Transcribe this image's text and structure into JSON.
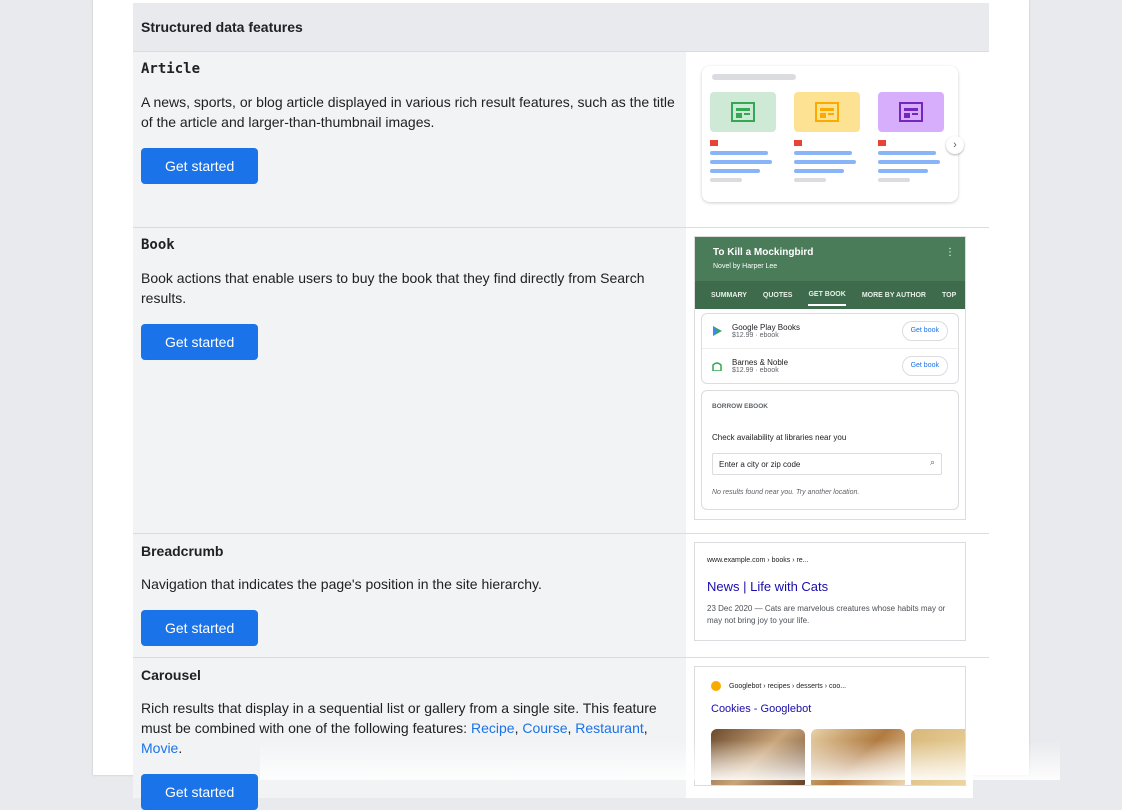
{
  "table": {
    "header": "Structured data features"
  },
  "rows": [
    {
      "name": "Article",
      "description": "A news, sports, or blog article displayed in various rich result features, such as the title of the article and larger-than-thumbnail images.",
      "button": "Get started"
    },
    {
      "name": "Book",
      "description": "Book actions that enable users to buy the book that they find directly from Search results.",
      "button": "Get started"
    },
    {
      "name": "Breadcrumb",
      "description": "Navigation that indicates the page's position in the site hierarchy.",
      "button": "Get started"
    },
    {
      "name": "Carousel",
      "description_prefix": "Rich results that display in a sequential list or gallery from a single site. This feature must be combined with one of the following features: ",
      "links": [
        "Recipe",
        "Course",
        "Restaurant",
        "Movie"
      ],
      "button": "Get started"
    }
  ],
  "book_preview": {
    "title": "To Kill a Mockingbird",
    "subtitle": "Novel by Harper Lee",
    "tabs": [
      "SUMMARY",
      "QUOTES",
      "GET BOOK",
      "MORE BY AUTHOR",
      "TOP"
    ],
    "sellers": [
      {
        "name": "Google Play Books",
        "price": "$12.99 · ebook",
        "action": "Get book"
      },
      {
        "name": "Barnes & Noble",
        "price": "$12.99 · ebook",
        "action": "Get book"
      }
    ],
    "borrow_header": "BORROW EBOOK",
    "borrow_question": "Check availability at libraries near you",
    "borrow_placeholder": "Enter a city or zip code",
    "borrow_note": "No results found near you. Try another location."
  },
  "breadcrumb_preview": {
    "url": "www.example.com › books › re...",
    "title": "News | Life with Cats",
    "snippet": "23 Dec 2020 — Cats are marvelous creatures whose habits may or may not bring joy to your life."
  },
  "carousel_preview": {
    "source": "Googlebot › recipes › desserts › coo...",
    "title": "Cookies - Googlebot"
  },
  "colors": {
    "accent": "#1a73e8",
    "row_bg": "#f1f3f4",
    "header_bg": "#e8eaed"
  }
}
